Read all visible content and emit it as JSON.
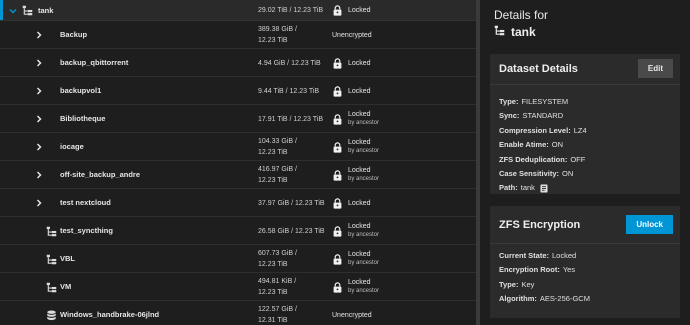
{
  "datasets": [
    {
      "name": "tank",
      "used": "29.02 TiB / 12.23 TiB",
      "used_line2": "",
      "status": "Locked",
      "status_sub": "",
      "locked": true,
      "indent": 0,
      "expanded": true,
      "expandable": true,
      "icon": "dataset-tree-icon",
      "selected": true
    },
    {
      "name": "Backup",
      "used": "389.38 GiB /",
      "used_line2": "12.23 TiB",
      "status": "Unencrypted",
      "status_sub": "",
      "locked": false,
      "indent": 1,
      "expandable": true,
      "icon": "",
      "selected": false
    },
    {
      "name": "backup_qbittorrent",
      "used": "4.94 GiB / 12.23 TiB",
      "used_line2": "",
      "status": "Locked",
      "status_sub": "",
      "locked": true,
      "indent": 1,
      "expandable": true,
      "icon": "",
      "selected": false
    },
    {
      "name": "backupvol1",
      "used": "9.44 TiB / 12.23 TiB",
      "used_line2": "",
      "status": "Locked",
      "status_sub": "",
      "locked": true,
      "indent": 1,
      "expandable": true,
      "icon": "",
      "selected": false
    },
    {
      "name": "Bibliotheque",
      "used": "17.91 TiB / 12.23 TiB",
      "used_line2": "",
      "status": "Locked",
      "status_sub": "by ancestor",
      "locked": true,
      "indent": 1,
      "expandable": true,
      "icon": "",
      "selected": false
    },
    {
      "name": "iocage",
      "used": "104.33 GiB /",
      "used_line2": "12.23 TiB",
      "status": "Locked",
      "status_sub": "by ancestor",
      "locked": true,
      "indent": 1,
      "expandable": true,
      "icon": "",
      "selected": false
    },
    {
      "name": "off-site_backup_andre",
      "used": "416.97 GiB /",
      "used_line2": "12.23 TiB",
      "status": "Locked",
      "status_sub": "by ancestor",
      "locked": true,
      "indent": 1,
      "expandable": true,
      "icon": "",
      "selected": false
    },
    {
      "name": "test nextcloud",
      "used": "37.97 GiB / 12.23 TiB",
      "used_line2": "",
      "status": "Locked",
      "status_sub": "",
      "locked": true,
      "indent": 1,
      "expandable": true,
      "icon": "",
      "selected": false
    },
    {
      "name": "test_syncthing",
      "used": "26.58 GiB / 12.23 TiB",
      "used_line2": "",
      "status": "Locked",
      "status_sub": "by ancestor",
      "locked": true,
      "indent": 1,
      "expandable": false,
      "icon": "dataset-tree-icon",
      "selected": false
    },
    {
      "name": "VBL",
      "used": "607.73 GiB /",
      "used_line2": "12.23 TiB",
      "status": "Locked",
      "status_sub": "by ancestor",
      "locked": true,
      "indent": 1,
      "expandable": false,
      "icon": "dataset-tree-icon",
      "selected": false
    },
    {
      "name": "VM",
      "used": "494.81 KiB /",
      "used_line2": "12.23 TiB",
      "status": "Locked",
      "status_sub": "by ancestor",
      "locked": true,
      "indent": 1,
      "expandable": false,
      "icon": "dataset-tree-icon",
      "selected": false
    },
    {
      "name": "Windows_handbrake-06jlnd",
      "used": "122.57 GiB /",
      "used_line2": "12.31 TiB",
      "status": "Unencrypted",
      "status_sub": "",
      "locked": false,
      "indent": 1,
      "expandable": false,
      "icon": "database-icon",
      "selected": false
    }
  ],
  "details": {
    "heading": "Details for",
    "dataset_name": "tank"
  },
  "dataset_details": {
    "title": "Dataset Details",
    "edit_label": "Edit",
    "props": [
      {
        "k": "Type:",
        "v": "FILESYSTEM"
      },
      {
        "k": "Sync:",
        "v": "STANDARD"
      },
      {
        "k": "Compression Level:",
        "v": "LZ4"
      },
      {
        "k": "Enable Atime:",
        "v": "ON"
      },
      {
        "k": "ZFS Deduplication:",
        "v": "OFF"
      },
      {
        "k": "Case Sensitivity:",
        "v": "ON"
      },
      {
        "k": "Path:",
        "v": "tank"
      }
    ]
  },
  "encryption": {
    "title": "ZFS Encryption",
    "unlock_label": "Unlock",
    "props": [
      {
        "k": "Current State:",
        "v": "Locked"
      },
      {
        "k": "Encryption Root:",
        "v": "Yes"
      },
      {
        "k": "Type:",
        "v": "Key"
      },
      {
        "k": "Algorithm:",
        "v": "AES-256-GCM"
      }
    ]
  },
  "colors": {
    "accent": "#0095d5",
    "background": "#1e1e1e",
    "card": "#2b2b2b"
  }
}
